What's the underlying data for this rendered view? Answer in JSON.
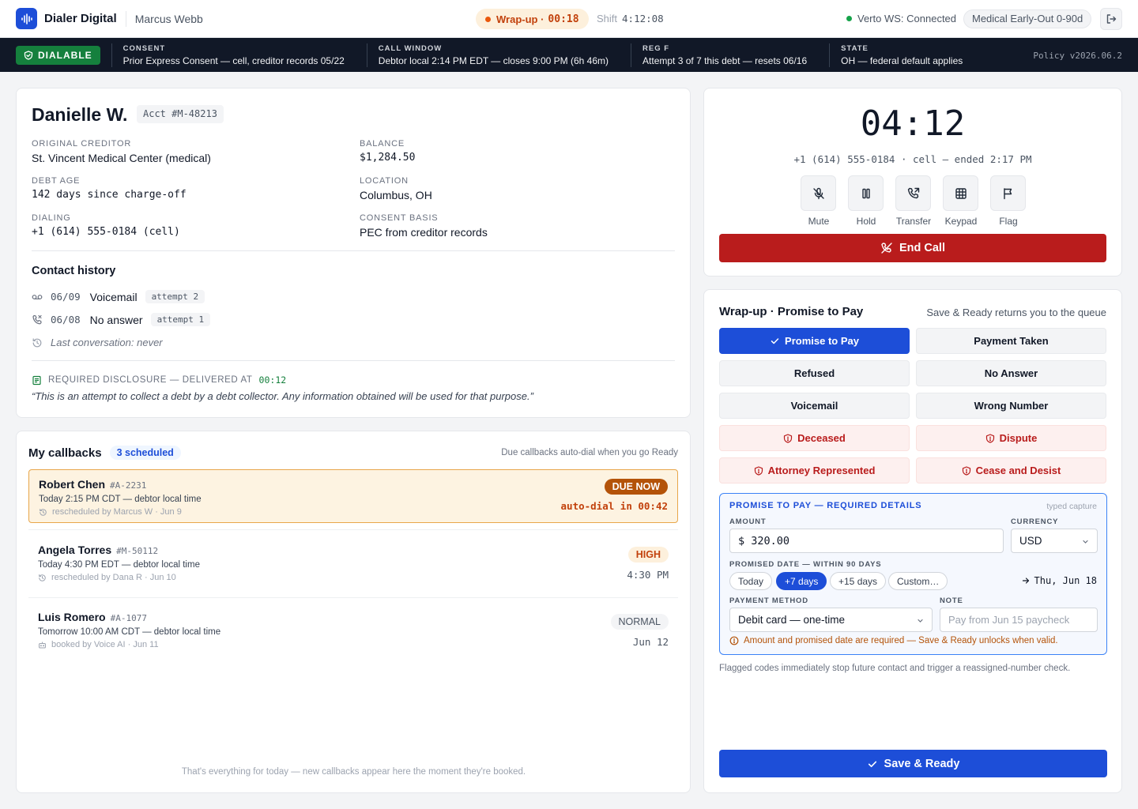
{
  "topbar": {
    "app_name": "Dialer Digital",
    "agent_name": "Marcus Webb",
    "status_label": "Wrap-up ·",
    "status_timer": "00:18",
    "shift_label": "Shift",
    "shift_time": "4:12:08",
    "connection_status": "Verto WS: Connected",
    "policy_chip": "Medical Early-Out 0-90d"
  },
  "compliance": {
    "badge": "DIALABLE",
    "segments": [
      {
        "key": "CONSENT",
        "value": "Prior Express Consent — cell, creditor records 05/22"
      },
      {
        "key": "CALL WINDOW",
        "value": "Debtor local 2:14 PM EDT — closes 9:00 PM (6h 46m)"
      },
      {
        "key": "REG F",
        "value": "Attempt 3 of 7 this debt — resets 06/16"
      },
      {
        "key": "STATE",
        "value": "OH — federal default applies"
      }
    ],
    "policy_version": "Policy v2026.06.2"
  },
  "debtor": {
    "name": "Danielle W.",
    "account": "Acct #M-48213",
    "fields": [
      {
        "label": "ORIGINAL CREDITOR",
        "value": "St. Vincent Medical Center (medical)"
      },
      {
        "label": "BALANCE",
        "value": "$1,284.50"
      },
      {
        "label": "DEBT AGE",
        "value": "142 days since charge-off"
      },
      {
        "label": "LOCATION",
        "value": "Columbus, OH"
      },
      {
        "label": "DIALING",
        "value": "+1 (614) 555-0184 (cell)"
      },
      {
        "label": "CONSENT BASIS",
        "value": "PEC from creditor records"
      }
    ],
    "history_title": "Contact history",
    "history": [
      {
        "date": "06/09",
        "type": "Voicemail",
        "attempt": "attempt 2",
        "icon": "voicemail-icon"
      },
      {
        "date": "06/08",
        "type": "No answer",
        "attempt": "attempt 1",
        "icon": "phone-missed-icon"
      }
    ],
    "last_conversation": "Last conversation: never",
    "disclosure_label": "REQUIRED DISCLOSURE — DELIVERED AT",
    "disclosure_time": "00:12",
    "disclosure_text": "“This is an attempt to collect a debt by a debt collector. Any information obtained will be used for that purpose.”"
  },
  "callbacks": {
    "title": "My callbacks",
    "count": "3 scheduled",
    "note": "Due callbacks auto-dial when you go Ready",
    "items": [
      {
        "name": "Robert Chen",
        "account": "#A-2231",
        "when": "Today 2:15 PM CDT — debtor local time",
        "meta": "rescheduled by Marcus W · Jun 9",
        "priority": "DUE NOW",
        "right": "auto-dial in 00:42"
      },
      {
        "name": "Angela Torres",
        "account": "#M-50112",
        "when": "Today 4:30 PM EDT — debtor local time",
        "meta": "rescheduled by Dana R · Jun 10",
        "priority": "HIGH",
        "right": "4:30 PM"
      },
      {
        "name": "Luis Romero",
        "account": "#A-1077",
        "when": "Tomorrow 10:00 AM CDT — debtor local time",
        "meta": "booked by Voice AI · Jun 11",
        "priority": "NORMAL",
        "right": "Jun 12"
      }
    ],
    "footer": "That's everything for today — new callbacks appear here the moment they're booked."
  },
  "call": {
    "timer": "04:12",
    "line": "+1 (614) 555-0184 · cell — ended 2:17 PM",
    "controls": [
      {
        "label": "Mute",
        "icon": "mic-off-icon"
      },
      {
        "label": "Hold",
        "icon": "pause-icon"
      },
      {
        "label": "Transfer",
        "icon": "phone-transfer-icon"
      },
      {
        "label": "Keypad",
        "icon": "keypad-icon"
      },
      {
        "label": "Flag",
        "icon": "flag-icon"
      }
    ],
    "end_label": "End Call"
  },
  "wrapup": {
    "title": "Wrap-up · Promise to Pay",
    "note": "Save & Ready returns you to the queue",
    "dispositions": [
      {
        "label": "Promise to Pay",
        "state": "selected"
      },
      {
        "label": "Payment Taken",
        "state": "normal"
      },
      {
        "label": "Refused",
        "state": "normal"
      },
      {
        "label": "No Answer",
        "state": "normal"
      },
      {
        "label": "Voicemail",
        "state": "normal"
      },
      {
        "label": "Wrong Number",
        "state": "normal"
      },
      {
        "label": "Deceased",
        "state": "flagged"
      },
      {
        "label": "Dispute",
        "state": "flagged"
      },
      {
        "label": "Attorney Represented",
        "state": "flagged"
      },
      {
        "label": "Cease and Desist",
        "state": "flagged"
      }
    ],
    "ptp": {
      "header": "PROMISE TO PAY — REQUIRED DETAILS",
      "typed": "typed capture",
      "amount_label": "AMOUNT",
      "amount_value": "$ 320.00",
      "currency_label": "CURRENCY",
      "currency_value": "USD",
      "date_label": "PROMISED DATE — WITHIN 90 DAYS",
      "date_chips": [
        "Today",
        "+7 days",
        "+15 days",
        "Custom…"
      ],
      "date_selected": "+7 days",
      "date_resolved": "Thu, Jun 18",
      "method_label": "PAYMENT METHOD",
      "method_value": "Debit card — one-time",
      "note_label": "NOTE",
      "note_placeholder": "Pay from Jun 15 paycheck",
      "error": "Amount and promised date are required — Save & Ready unlocks when valid."
    },
    "flag_note": "Flagged codes immediately stop future contact and trigger a reassigned-number check.",
    "save_label": "Save & Ready"
  },
  "colors": {
    "accent": "#1d4ed8",
    "danger": "#b91c1c",
    "dialable": "#15803d",
    "warning": "#c2410c"
  }
}
